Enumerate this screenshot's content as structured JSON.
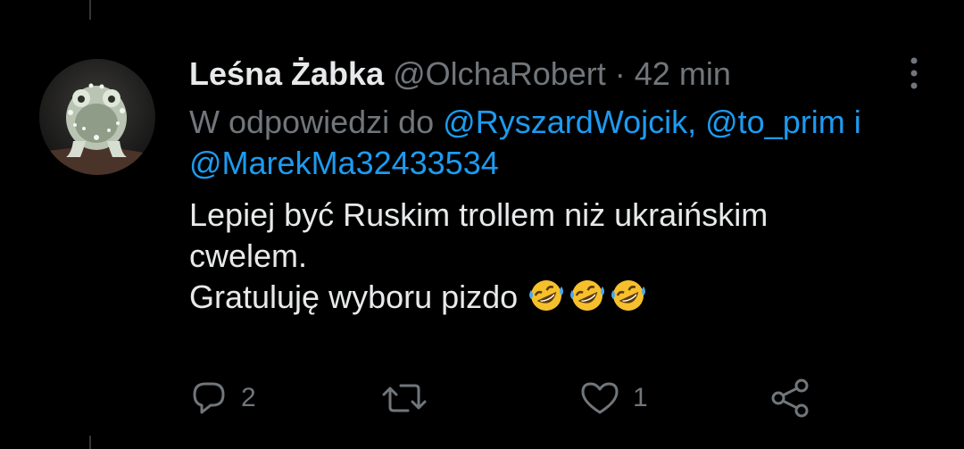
{
  "tweet": {
    "display_name": "Leśna Żabka",
    "handle": "@OlchaRobert",
    "separator": "·",
    "time": "42 min",
    "reply_prefix": "W odpowiedzi do",
    "mention_1": "@RyszardWojcik,",
    "mention_2": "@to_prim",
    "reply_and": "i",
    "mention_3": "@MarekMa32433534",
    "text_line_1": "Lepiej być Ruskim trollem niż ukraińskim",
    "text_line_2": "cwelem.",
    "text_line_3": "Gratuluję wyboru pizdo",
    "emoji": "rolling-on-floor-laughing-emoji"
  },
  "actions": {
    "reply_count": "2",
    "retweet_count": "",
    "like_count": "1"
  },
  "icons": {
    "avatar": "frosted-frog-avatar",
    "more": "more-vertical-icon",
    "reply": "reply-bubble-icon",
    "retweet": "retweet-icon",
    "like": "heart-icon",
    "share": "share-icon"
  },
  "colors": {
    "background": "#000000",
    "text": "#e7e9ea",
    "secondary": "#71767b",
    "link": "#1d9bf0"
  }
}
